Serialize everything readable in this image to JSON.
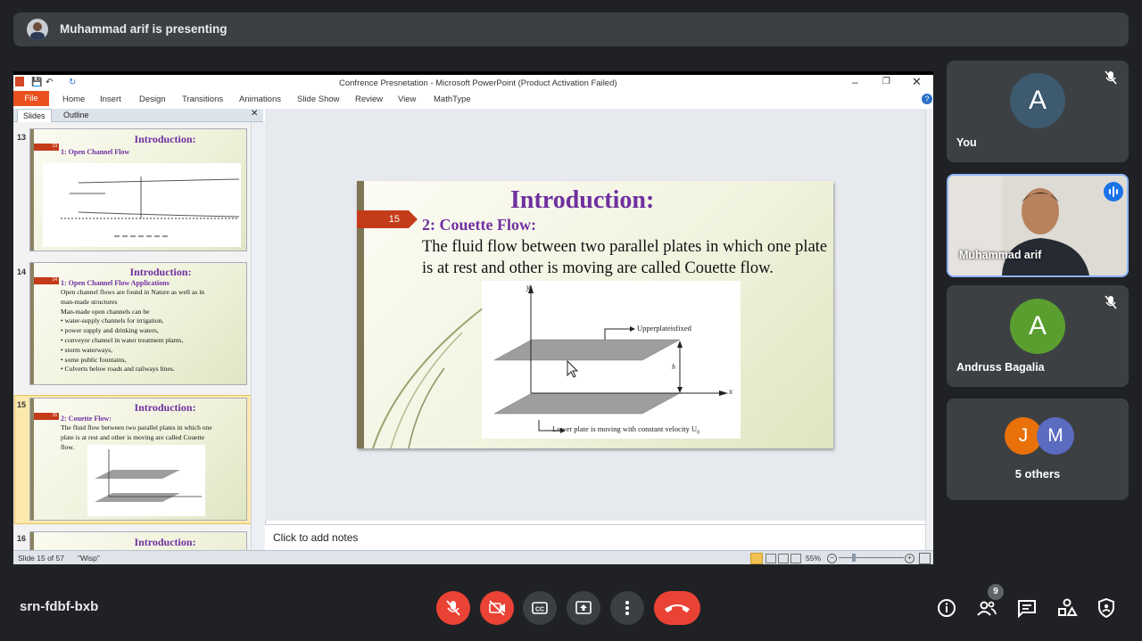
{
  "presenting_bar": {
    "text": "Muhammad arif is presenting"
  },
  "powerpoint": {
    "window_title": "Confrence Presnetation - Microsoft PowerPoint (Product Activation Failed)",
    "ribbon_tabs": [
      "File",
      "Home",
      "Insert",
      "Design",
      "Transitions",
      "Animations",
      "Slide Show",
      "Review",
      "View",
      "MathType"
    ],
    "panel_tabs": [
      "Slides",
      "Outline"
    ],
    "thumbnails": [
      {
        "num": "13",
        "title": "Introduction:",
        "subtitle": "1: Open Channel Flow",
        "tag": "13"
      },
      {
        "num": "14",
        "title": "Introduction:",
        "subtitle": "1: Open Channel Flow Applications",
        "tag": "14",
        "body": [
          "Open channel flows are found in Nature as well as in",
          "man-made structures",
          "Man-made open channels can be",
          "•  water-supply channels for irrigation,",
          "•  power supply and drinking waters,",
          "•  conveyor channel in water treatment plants,",
          "•  storm waterways,",
          "•  some public fountains,",
          "•  Culverts below roads and railways lines."
        ]
      },
      {
        "num": "15",
        "title": "Introduction:",
        "subtitle": "2: Couette Flow:",
        "tag": "15",
        "body": [
          "The fluid flow between two parallel plates in which one",
          "plate is at rest and other is moving  are called Couette",
          "flow."
        ]
      },
      {
        "num": "16",
        "title": "Introduction:"
      }
    ],
    "slide": {
      "number": "15",
      "title": "Introduction:",
      "subtitle": "2: Couette Flow:",
      "body": "The fluid flow between two parallel plates in which one plate is at rest and other is moving  are called Couette flow.",
      "diagram": {
        "y_label": "y",
        "x_label": "x",
        "h_label": "h",
        "upper_label": "Upperplateisfixed",
        "lower_label": "Lower plate is moving with constant velocity U",
        "lower_sub": "0"
      }
    },
    "notes_placeholder": "Click to add notes",
    "status": {
      "slide_info": "Slide 15 of 57",
      "theme": "\"Wisp\"",
      "zoom": "55%"
    }
  },
  "participants": [
    {
      "name": "You",
      "initial": "A",
      "color": "#3d5a6e",
      "muted": true
    },
    {
      "name": "Muhammad arif",
      "speaking": true
    },
    {
      "name": "Andruss Bagalia",
      "initial": "A",
      "color": "#5a9e2f",
      "muted": true
    },
    {
      "name": "5 others",
      "avatars": [
        {
          "initial": "J",
          "color": "#e8710a"
        },
        {
          "initial": "M",
          "color": "#5b6bc0"
        }
      ]
    }
  ],
  "bottom_bar": {
    "meeting_code": "srn-fdbf-bxb",
    "people_count": "9",
    "colors": {
      "danger": "#ea4335",
      "neutral": "#3c4043"
    }
  }
}
